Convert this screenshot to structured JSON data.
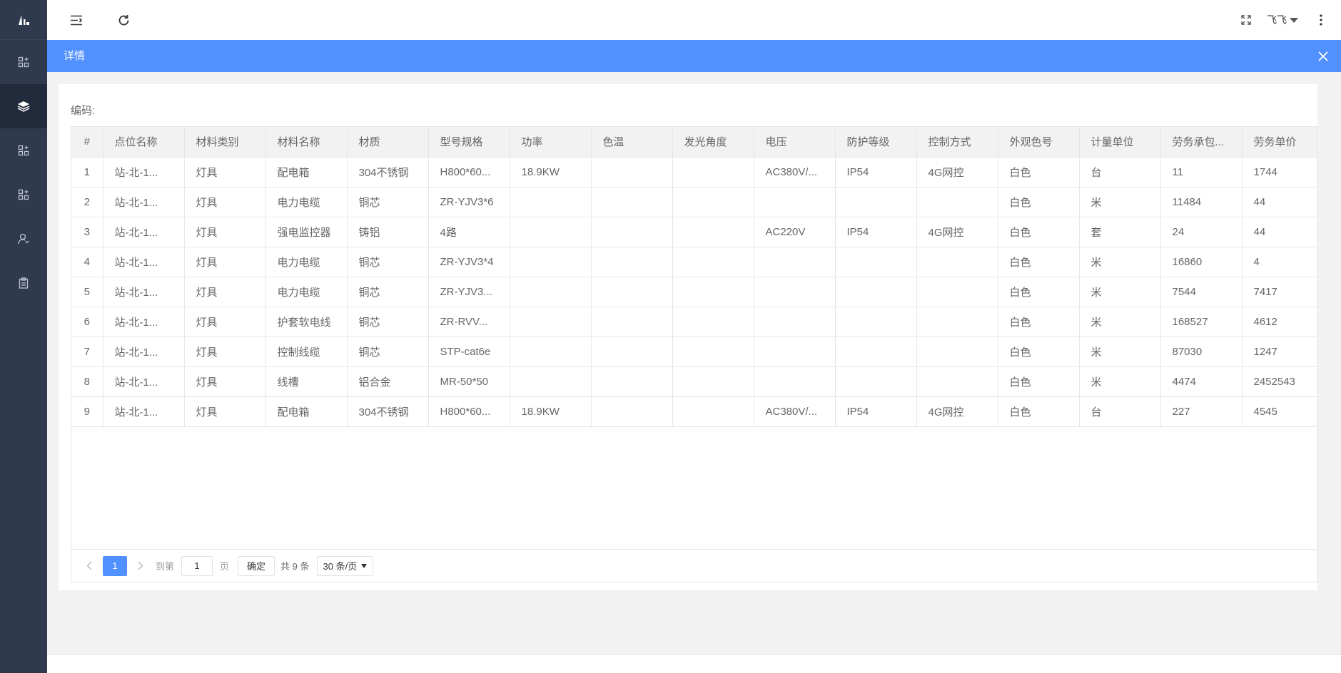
{
  "header": {
    "user_name": "飞飞"
  },
  "detail": {
    "title": "详情",
    "code_label": "编码:"
  },
  "table": {
    "columns": [
      "#",
      "点位名称",
      "材料类别",
      "材料名称",
      "材质",
      "型号规格",
      "功率",
      "色温",
      "发光角度",
      "电压",
      "防护等级",
      "控制方式",
      "外观色号",
      "计量单位",
      "劳务承包...",
      "劳务单价"
    ],
    "rows": [
      [
        "1",
        "站-北-1...",
        "灯具",
        "配电箱",
        "304不锈钢",
        "H800*60...",
        "18.9KW",
        "",
        "",
        "AC380V/...",
        "IP54",
        "4G网控",
        "白色",
        "台",
        "11",
        "1744"
      ],
      [
        "2",
        "站-北-1...",
        "灯具",
        "电力电缆",
        "铜芯",
        "ZR-YJV3*6",
        "",
        "",
        "",
        "",
        "",
        "",
        "白色",
        "米",
        "11484",
        "44"
      ],
      [
        "3",
        "站-北-1...",
        "灯具",
        "强电监控器",
        "铸铝",
        "4路",
        "",
        "",
        "",
        "AC220V",
        "IP54",
        "4G网控",
        "白色",
        "套",
        "24",
        "44"
      ],
      [
        "4",
        "站-北-1...",
        "灯具",
        "电力电缆",
        "铜芯",
        "ZR-YJV3*4",
        "",
        "",
        "",
        "",
        "",
        "",
        "白色",
        "米",
        "16860",
        "4"
      ],
      [
        "5",
        "站-北-1...",
        "灯具",
        "电力电缆",
        "铜芯",
        "ZR-YJV3...",
        "",
        "",
        "",
        "",
        "",
        "",
        "白色",
        "米",
        "7544",
        "7417"
      ],
      [
        "6",
        "站-北-1...",
        "灯具",
        "护套软电线",
        "铜芯",
        "ZR-RVV...",
        "",
        "",
        "",
        "",
        "",
        "",
        "白色",
        "米",
        "168527",
        "4612"
      ],
      [
        "7",
        "站-北-1...",
        "灯具",
        "控制线缆",
        "铜芯",
        "STP-cat6e",
        "",
        "",
        "",
        "",
        "",
        "",
        "白色",
        "米",
        "87030",
        "1247"
      ],
      [
        "8",
        "站-北-1...",
        "灯具",
        "线槽",
        "铝合金",
        "MR-50*50",
        "",
        "",
        "",
        "",
        "",
        "",
        "白色",
        "米",
        "4474",
        "2452543"
      ],
      [
        "9",
        "站-北-1...",
        "灯具",
        "配电箱",
        "304不锈钢",
        "H800*60...",
        "18.9KW",
        "",
        "",
        "AC380V/...",
        "IP54",
        "4G网控",
        "白色",
        "台",
        "227",
        "4545"
      ]
    ]
  },
  "pagination": {
    "current_page": "1",
    "goto_prefix": "到第",
    "goto_value": "1",
    "goto_suffix": "页",
    "confirm_label": "确定",
    "total_label": "共 9 条",
    "page_size_label": "30 条/页"
  },
  "colors": {
    "sidebar_bg": "#2f3a4f",
    "accent": "#5190ff"
  }
}
